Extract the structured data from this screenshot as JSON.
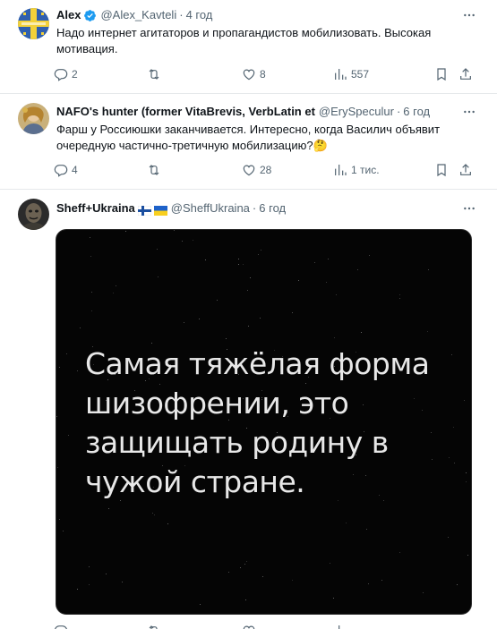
{
  "tweets": [
    {
      "name": "Alex",
      "handle": "@Alex_Kavteli",
      "time": "4 год",
      "text": "Надо интернет агитаторов и пропагандистов мобилизовать. Высокая мотивация.",
      "replies": "2",
      "retweets": "",
      "likes": "8",
      "views": "557"
    },
    {
      "name": "NAFO's hunter (former VitaBrevis, VerbLatin et",
      "handle": "@ErySpeculur",
      "time": "6 год",
      "text": "Фарш у Россиюшки заканчивается. Интересно, когда Василич объявит очередную частично-третичную мобилизацию?🤔",
      "replies": "4",
      "retweets": "",
      "likes": "28",
      "views": "1 тис."
    },
    {
      "name": "Sheff+Ukraina",
      "handle": "@SheffUkraina",
      "time": "6 год",
      "media_text": "Самая тяжёлая форма шизофрении, это защищать родину в чужой стране."
    }
  ],
  "colors": {
    "text": "#0f1419",
    "secondary": "#536471",
    "verified": "#1d9bf0",
    "divider": "#e6e9eb"
  },
  "icons": [
    "verified-badge-icon",
    "more-icon",
    "reply-icon",
    "retweet-icon",
    "like-icon",
    "views-icon",
    "bookmark-icon",
    "share-icon",
    "finland-flag-icon",
    "ukraine-flag-icon"
  ]
}
